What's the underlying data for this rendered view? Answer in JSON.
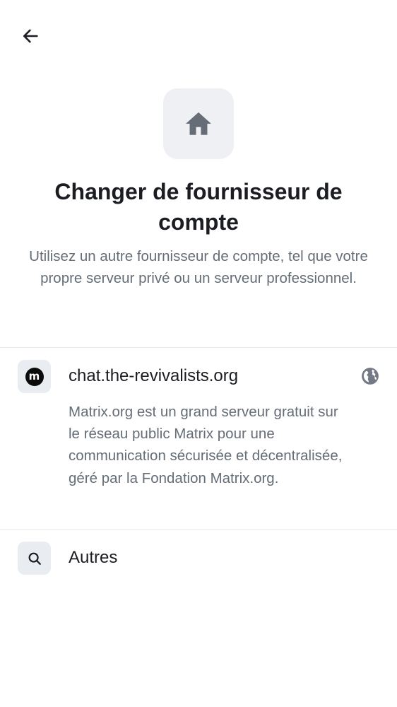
{
  "header": {
    "back_icon": "arrow-left-icon"
  },
  "hero": {
    "icon": "home-icon",
    "title": "Changer de fournisseur de compte",
    "subtitle": "Utilisez un autre fournisseur de compte, tel que votre propre serveur privé ou un serveur professionnel."
  },
  "providers": {
    "server": {
      "icon": "matrix-logo-icon",
      "icon_glyph": "m",
      "name": "chat.the-revivalists.org",
      "description": "Matrix.org est un grand serveur gratuit sur le réseau public Matrix pour une communication sécurisée et décentralisée, géré par la Fondation Matrix.org.",
      "badge_icon": "globe-icon"
    },
    "other": {
      "icon": "search-icon",
      "label": "Autres"
    }
  },
  "colors": {
    "icon_tile": "#eef0f4",
    "text_primary": "#1b1d22",
    "text_secondary": "#656d77",
    "divider": "#e9ebee"
  }
}
